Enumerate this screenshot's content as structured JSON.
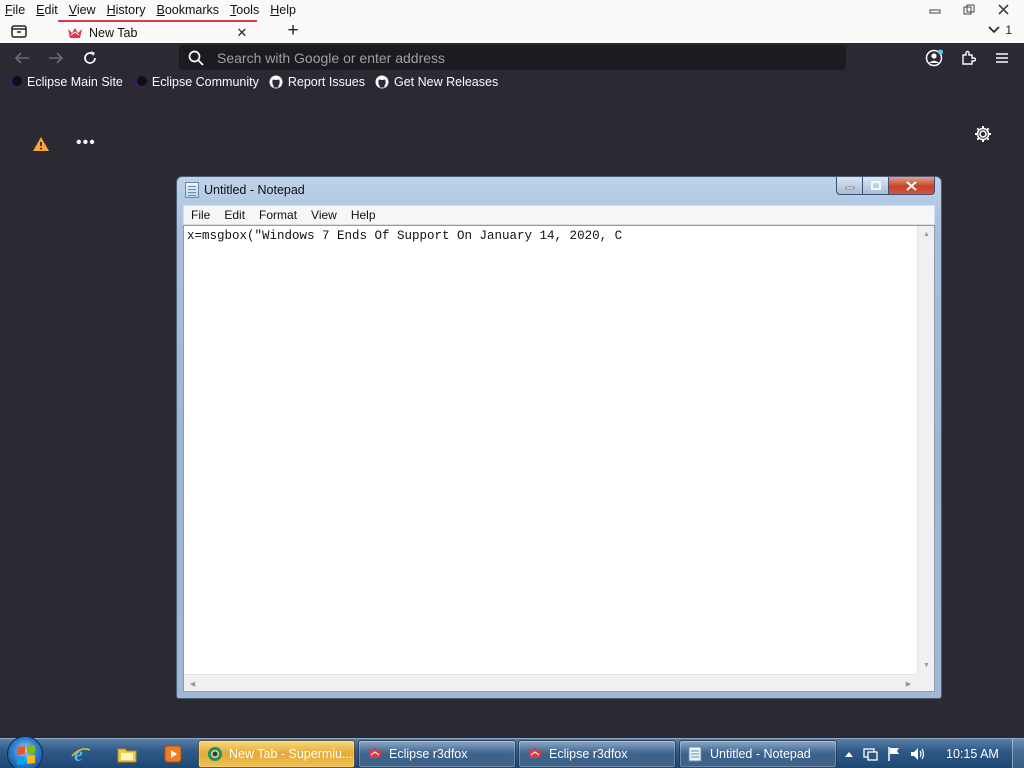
{
  "browser": {
    "menus": [
      {
        "key": "F",
        "rest": "ile"
      },
      {
        "key": "E",
        "rest": "dit"
      },
      {
        "key": "V",
        "rest": "iew"
      },
      {
        "key": "",
        "rest": "History",
        "underline": "H"
      },
      {
        "key": "B",
        "rest": "ookmarks"
      },
      {
        "key": "T",
        "rest": "ools"
      },
      {
        "key": "H",
        "rest": "elp"
      }
    ],
    "menu_labels": [
      "File",
      "Edit",
      "View",
      "History",
      "Bookmarks",
      "Tools",
      "Help"
    ],
    "tab": {
      "title": "New Tab"
    },
    "tab_count": "1",
    "urlbar": {
      "placeholder": "Search with Google or enter address"
    },
    "bookmarks": [
      {
        "label": "Eclipse Main Site",
        "icon": "eclipse-icon"
      },
      {
        "label": "Eclipse Community",
        "icon": "eclipse-icon"
      },
      {
        "label": "Report Issues",
        "icon": "github-icon"
      },
      {
        "label": "Get New Releases",
        "icon": "github-icon"
      }
    ]
  },
  "notepad": {
    "title": "Untitled - Notepad",
    "menus": [
      "File",
      "Edit",
      "Format",
      "View",
      "Help"
    ],
    "content": "x=msgbox(\"Windows 7 Ends Of Support On January 14, 2020, C"
  },
  "taskbar": {
    "buttons": [
      {
        "label": "New Tab - Supermiu...",
        "icon": "browser-icon",
        "active": true
      },
      {
        "label": "Eclipse r3dfox",
        "icon": "r3dfox-icon",
        "active": false
      },
      {
        "label": "Eclipse r3dfox",
        "icon": "r3dfox-icon",
        "active": false
      },
      {
        "label": "Untitled - Notepad",
        "icon": "notepad-icon",
        "active": false
      }
    ],
    "clock": "10:15 AM"
  },
  "colors": {
    "browser_bg": "#2b2a33",
    "tab_accent": "#e0374b",
    "taskbar_active": "#e3a935"
  }
}
